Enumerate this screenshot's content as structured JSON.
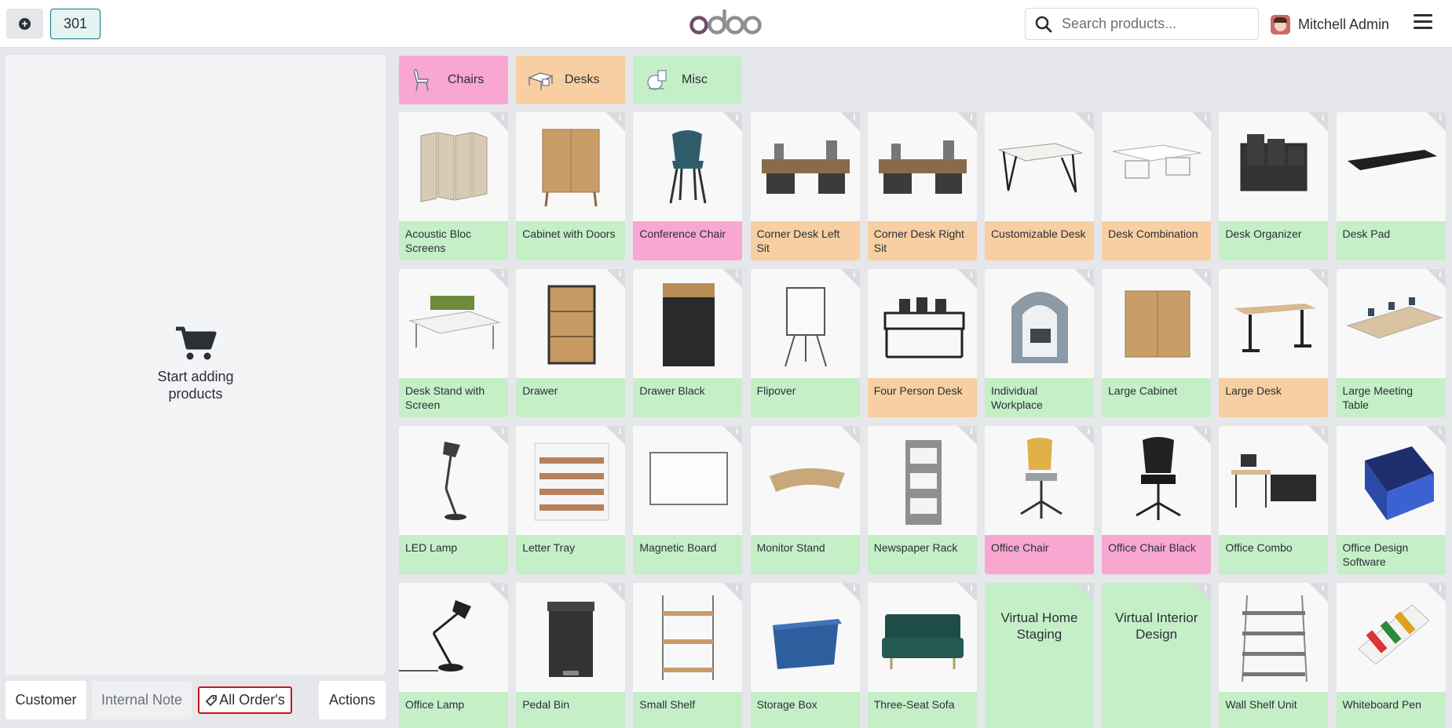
{
  "header": {
    "order_number": "301",
    "logo_text": "odoo",
    "search_placeholder": "Search products...",
    "user_name": "Mitchell Admin"
  },
  "order_pane": {
    "empty_line1": "Start adding",
    "empty_line2": "products"
  },
  "controls": {
    "customer": "Customer",
    "internal_note": "Internal Note",
    "all_orders": "All Order's",
    "actions": "Actions"
  },
  "categories": [
    {
      "label": "Chairs",
      "color": "#f8a7d1",
      "icon": "chair-icon"
    },
    {
      "label": "Desks",
      "color": "#f7cfa2",
      "icon": "desk-icon"
    },
    {
      "label": "Misc",
      "color": "#c5efc7",
      "icon": "misc-icon"
    }
  ],
  "products": [
    {
      "name": "Acoustic Bloc Screens",
      "category_color": "green",
      "icon": "screens-icon"
    },
    {
      "name": "Cabinet with Doors",
      "category_color": "green",
      "icon": "cabinet-icon"
    },
    {
      "name": "Conference Chair",
      "category_color": "pink",
      "icon": "chair-icon"
    },
    {
      "name": "Corner Desk Left Sit",
      "category_color": "orange",
      "icon": "corner-desk-icon"
    },
    {
      "name": "Corner Desk Right Sit",
      "category_color": "orange",
      "icon": "corner-desk-icon"
    },
    {
      "name": "Customizable Desk",
      "category_color": "orange",
      "icon": "desk-icon"
    },
    {
      "name": "Desk Combination",
      "category_color": "orange",
      "icon": "desk-combo-icon"
    },
    {
      "name": "Desk Organizer",
      "category_color": "green",
      "icon": "organizer-icon"
    },
    {
      "name": "Desk Pad",
      "category_color": "green",
      "icon": "desk-pad-icon"
    },
    {
      "name": "Desk Stand with Screen",
      "category_color": "green",
      "icon": "desk-stand-icon"
    },
    {
      "name": "Drawer",
      "category_color": "green",
      "icon": "drawer-icon"
    },
    {
      "name": "Drawer Black",
      "category_color": "green",
      "icon": "drawer-black-icon"
    },
    {
      "name": "Flipover",
      "category_color": "green",
      "icon": "flipover-icon"
    },
    {
      "name": "Four Person Desk",
      "category_color": "orange",
      "icon": "four-desk-icon"
    },
    {
      "name": "Individual Workplace",
      "category_color": "green",
      "icon": "workplace-icon"
    },
    {
      "name": "Large Cabinet",
      "category_color": "green",
      "icon": "large-cabinet-icon"
    },
    {
      "name": "Large Desk",
      "category_color": "orange",
      "icon": "large-desk-icon"
    },
    {
      "name": "Large Meeting Table",
      "category_color": "green",
      "icon": "meeting-table-icon"
    },
    {
      "name": "LED Lamp",
      "category_color": "green",
      "icon": "lamp-icon"
    },
    {
      "name": "Letter Tray",
      "category_color": "green",
      "icon": "letter-tray-icon"
    },
    {
      "name": "Magnetic Board",
      "category_color": "green",
      "icon": "board-icon"
    },
    {
      "name": "Monitor Stand",
      "category_color": "green",
      "icon": "monitor-stand-icon"
    },
    {
      "name": "Newspaper Rack",
      "category_color": "green",
      "icon": "rack-icon"
    },
    {
      "name": "Office Chair",
      "category_color": "pink",
      "icon": "office-chair-icon"
    },
    {
      "name": "Office Chair Black",
      "category_color": "pink",
      "icon": "office-chair-black-icon"
    },
    {
      "name": "Office Combo",
      "category_color": "green",
      "icon": "office-combo-icon"
    },
    {
      "name": "Office Design Software",
      "category_color": "green",
      "icon": "software-box-icon"
    },
    {
      "name": "Office Lamp",
      "category_color": "green",
      "icon": "office-lamp-icon"
    },
    {
      "name": "Pedal Bin",
      "category_color": "green",
      "icon": "bin-icon"
    },
    {
      "name": "Small Shelf",
      "category_color": "green",
      "icon": "small-shelf-icon"
    },
    {
      "name": "Storage Box",
      "category_color": "green",
      "icon": "storage-box-icon"
    },
    {
      "name": "Three-Seat Sofa",
      "category_color": "green",
      "icon": "sofa-icon"
    },
    {
      "name": "Virtual Home Staging",
      "category_color": "green",
      "icon": "",
      "service": true
    },
    {
      "name": "Virtual Interior Design",
      "category_color": "green",
      "icon": "",
      "service": true
    },
    {
      "name": "Wall Shelf Unit",
      "category_color": "green",
      "icon": "wall-shelf-icon"
    },
    {
      "name": "Whiteboard Pen",
      "category_color": "green",
      "icon": "pen-icon"
    }
  ],
  "info_glyph": "i"
}
